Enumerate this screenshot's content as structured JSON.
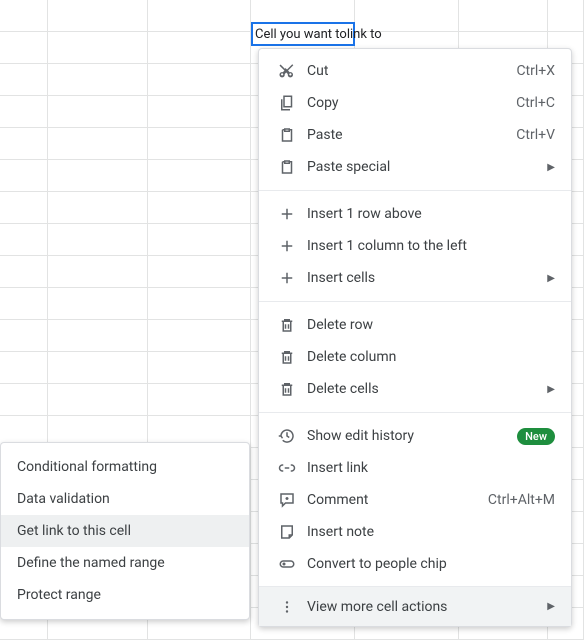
{
  "selected_cell": {
    "text_before_cursor": "Cell you want to",
    "text_after_cursor": "link to"
  },
  "context_menu": {
    "groups": [
      {
        "items": [
          {
            "icon": "cut-icon",
            "label": "Cut",
            "shortcut": "Ctrl+X"
          },
          {
            "icon": "copy-icon",
            "label": "Copy",
            "shortcut": "Ctrl+C"
          },
          {
            "icon": "paste-icon",
            "label": "Paste",
            "shortcut": "Ctrl+V"
          },
          {
            "icon": "paste-icon",
            "label": "Paste special",
            "submenu": true
          }
        ]
      },
      {
        "items": [
          {
            "icon": "plus-icon",
            "label": "Insert 1 row above"
          },
          {
            "icon": "plus-icon",
            "label": "Insert 1 column to the left"
          },
          {
            "icon": "plus-icon",
            "label": "Insert cells",
            "submenu": true
          }
        ]
      },
      {
        "items": [
          {
            "icon": "trash-icon",
            "label": "Delete row"
          },
          {
            "icon": "trash-icon",
            "label": "Delete column"
          },
          {
            "icon": "trash-icon",
            "label": "Delete cells",
            "submenu": true
          }
        ]
      },
      {
        "items": [
          {
            "icon": "history-icon",
            "label": "Show edit history",
            "badge": "New"
          },
          {
            "icon": "link-icon",
            "label": "Insert link"
          },
          {
            "icon": "comment-icon",
            "label": "Comment",
            "shortcut": "Ctrl+Alt+M"
          },
          {
            "icon": "note-icon",
            "label": "Insert note"
          },
          {
            "icon": "chip-icon",
            "label": "Convert to people chip"
          }
        ]
      }
    ],
    "footer": {
      "icon": "kebab-icon",
      "label": "View more cell actions",
      "submenu": true
    }
  },
  "submenu": {
    "items": [
      {
        "label": "Conditional formatting"
      },
      {
        "label": "Data validation"
      },
      {
        "label": "Get link to this cell",
        "hover": true
      },
      {
        "label": "Define the named range"
      },
      {
        "label": "Protect range"
      }
    ]
  }
}
